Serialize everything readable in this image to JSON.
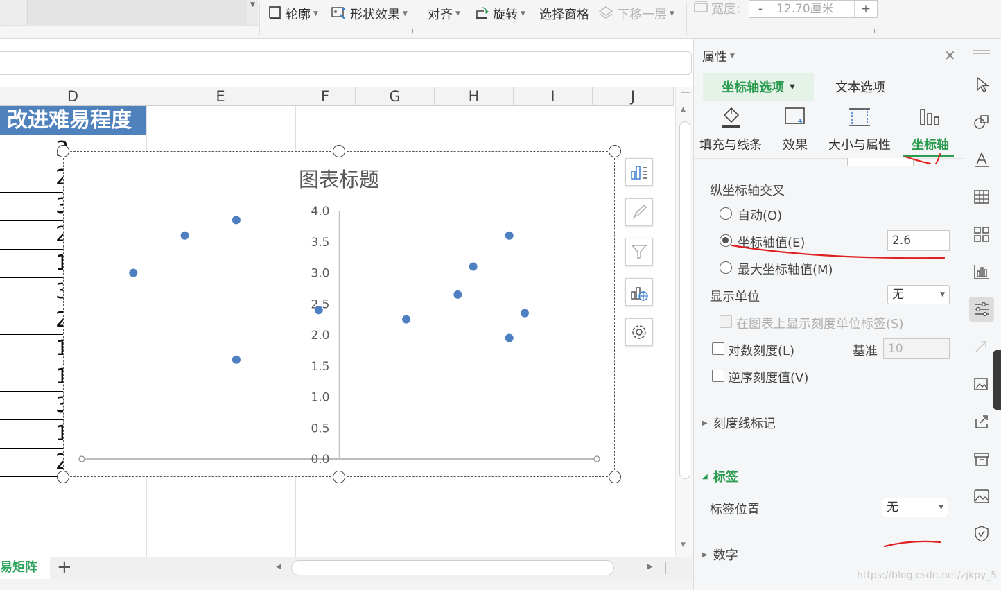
{
  "ribbon": {
    "outline_label": "轮廓",
    "shape_effect_label": "形状效果",
    "align_label": "对齐",
    "rotate_label": "旋转",
    "selection_pane_label": "选择窗格",
    "send_backward_label": "下移一层",
    "width_label": "宽度:",
    "width_value": "12.70厘米",
    "minus": "-",
    "plus": "+"
  },
  "sheet": {
    "columns": [
      "D",
      "E",
      "F",
      "G",
      "H",
      "I",
      "J"
    ],
    "header_cell": "改进难易程度",
    "cell_values": [
      "3.0",
      "2",
      "3",
      "2",
      "1",
      "3",
      "2",
      "1",
      "1",
      "3",
      "1",
      "2"
    ],
    "sheet_tab": "易矩阵",
    "add_sheet": "+"
  },
  "chart": {
    "side_tools": [
      "chart-elements-icon",
      "chart-style-icon",
      "chart-filter-icon",
      "chart-type-icon",
      "chart-settings-icon"
    ]
  },
  "chart_data": {
    "type": "scatter",
    "title": "图表标题",
    "xlabel": "",
    "ylabel": "",
    "x": [
      1,
      2,
      3,
      3,
      4.6,
      6.3,
      7.3,
      7.6,
      8.3,
      8.3,
      8.6
    ],
    "y": [
      3.0,
      3.6,
      3.85,
      1.6,
      2.4,
      2.25,
      2.65,
      3.1,
      3.6,
      1.95,
      2.35
    ],
    "ylim": [
      0,
      4
    ],
    "yticks": [
      "0.0",
      "0.5",
      "1.0",
      "1.5",
      "2.0",
      "2.5",
      "3.0",
      "3.5",
      "4.0"
    ],
    "y_axis_crosses_x": 5.0,
    "marker_color": "#4e7fc0",
    "grid": false,
    "legend": "none"
  },
  "panel": {
    "title": "属性",
    "tab_axis_options": "坐标轴选项",
    "tab_text_options": "文本选项",
    "cat_fill_line": "填充与线条",
    "cat_effect": "效果",
    "cat_size_props": "大小与属性",
    "cat_axis": "坐标轴",
    "vertical_axis_cross": "纵坐标轴交叉",
    "opt_auto": "自动(O)",
    "opt_axis_value": "坐标轴值(E)",
    "axis_value": "2.6",
    "opt_max_axis_value": "最大坐标轴值(M)",
    "display_units": "显示单位",
    "display_units_value": "无",
    "show_units_label": "在图表上显示刻度单位标签(S)",
    "log_scale": "对数刻度(L)",
    "base_label": "基准",
    "base_value": "10",
    "reverse_order": "逆序刻度值(V)",
    "tick_marks": "刻度线标记",
    "labels_section": "标签",
    "label_position": "标签位置",
    "label_position_value": "无",
    "number_section": "数字"
  },
  "watermark": "https://blog.csdn.net/zjkpy_5",
  "colors": {
    "accent": "#2a9b4f",
    "header_fill": "#4f81bd",
    "annotation_red": "#e02020"
  }
}
